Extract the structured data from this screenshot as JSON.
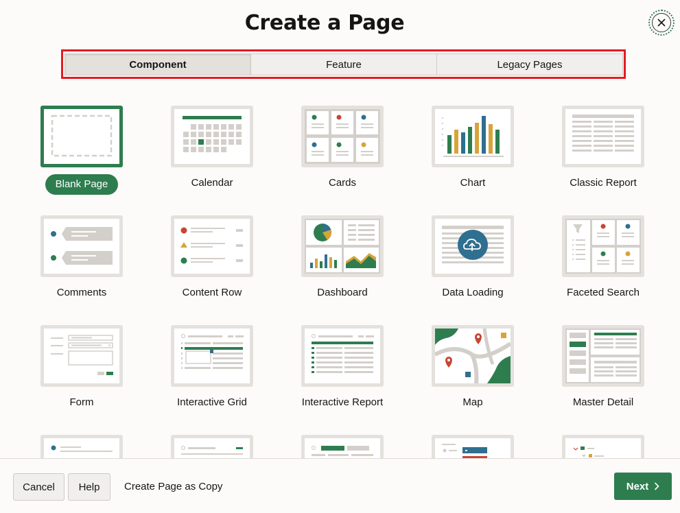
{
  "dialog": {
    "title": "Create a Page"
  },
  "tabs": [
    {
      "label": "Component",
      "active": true
    },
    {
      "label": "Feature",
      "active": false
    },
    {
      "label": "Legacy Pages",
      "active": false
    }
  ],
  "page_types": [
    {
      "label": "Blank Page",
      "selected": true
    },
    {
      "label": "Calendar"
    },
    {
      "label": "Cards"
    },
    {
      "label": "Chart"
    },
    {
      "label": "Classic Report"
    },
    {
      "label": "Comments"
    },
    {
      "label": "Content Row"
    },
    {
      "label": "Dashboard"
    },
    {
      "label": "Data Loading"
    },
    {
      "label": "Faceted Search"
    },
    {
      "label": "Form"
    },
    {
      "label": "Interactive Grid"
    },
    {
      "label": "Interactive Report"
    },
    {
      "label": "Map"
    },
    {
      "label": "Master Detail"
    }
  ],
  "footer": {
    "cancel_label": "Cancel",
    "help_label": "Help",
    "copy_label": "Create Page as Copy",
    "next_label": "Next"
  },
  "colors": {
    "accent_green": "#2e7d4f",
    "highlight_red": "#e31b23",
    "thumb_border": "#e4e1dd"
  }
}
